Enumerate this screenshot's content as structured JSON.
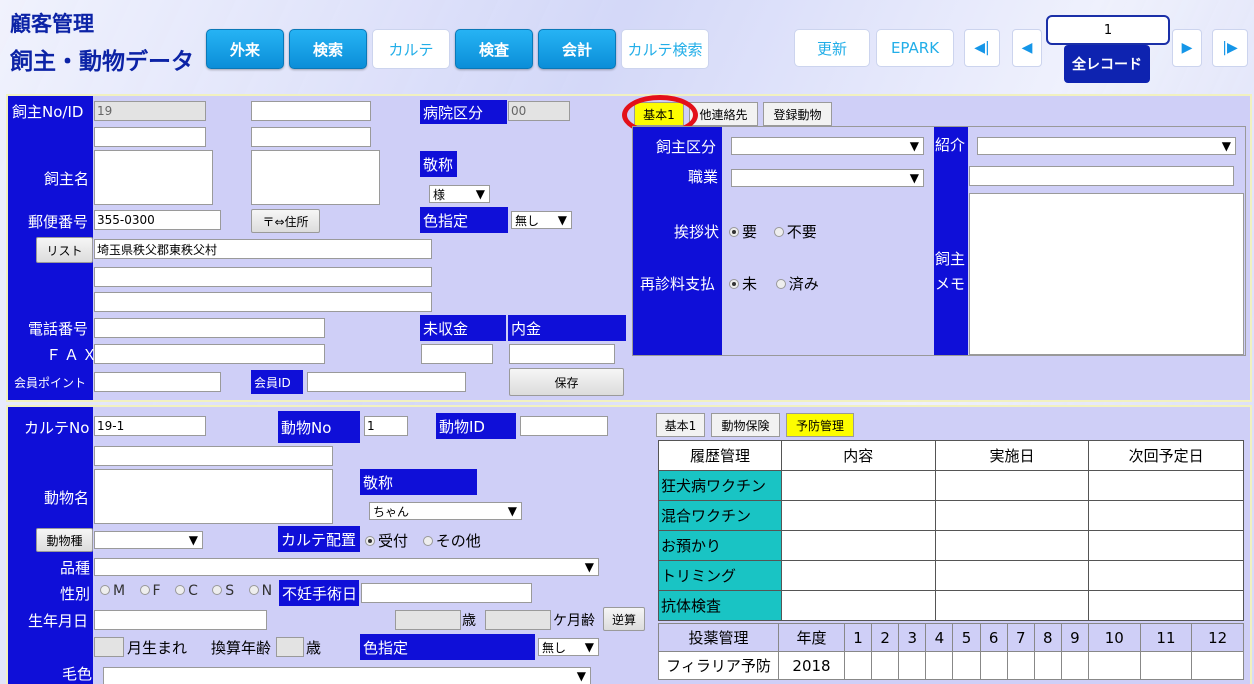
{
  "header": {
    "title1": "顧客管理",
    "title2": "飼主・動物データ"
  },
  "toolbar": {
    "outpatient": "外来",
    "search": "検索",
    "karte": "カルテ",
    "exam": "検査",
    "accounting": "会計",
    "karte_search": "カルテ検索",
    "update": "更新",
    "epark": "EPARK",
    "record_no": "1",
    "all_records": "全レコード"
  },
  "owner": {
    "id_label": "飼主No/ID",
    "id_value": "19",
    "hospital_div_label": "病院区分",
    "hospital_div_value": "00",
    "name_label": "飼主名",
    "honorific_label": "敬称",
    "honorific_value": "様",
    "zip_label": "郵便番号",
    "zip_value": "355-0300",
    "zip_to_addr_button": "〒⇔住所",
    "color_label": "色指定",
    "color_value": "無し",
    "list_button": "リスト",
    "address1": "埼玉県秩父郡東秩父村",
    "phone_label": "電話番号",
    "fax_label": "ＦＡＸ",
    "unpaid_label": "未収金",
    "deposit_label": "内金",
    "points_label": "会員ポイント",
    "member_id_label": "会員ID",
    "save_button": "保存"
  },
  "owner_tabs": {
    "basic1": "基本1",
    "other_contact": "他連絡先",
    "registered_animals": "登録動物"
  },
  "owner_basic": {
    "owner_div_label": "飼主区分",
    "job_label": "職業",
    "referral_label": "紹介",
    "greeting_label": "挨拶状",
    "greeting_yes": "要",
    "greeting_no": "不要",
    "revisit_label": "再診料支払",
    "revisit_unpaid": "未",
    "revisit_paid": "済み",
    "memo_label1": "飼主",
    "memo_label2": "メモ"
  },
  "animal": {
    "karte_no_label": "カルテNo",
    "karte_no_value": "19-1",
    "animal_no_label": "動物No",
    "animal_no_value": "1",
    "animal_id_label": "動物ID",
    "name_label": "動物名",
    "honorific_label": "敬称",
    "honorific_value": "ちゃん",
    "species_button": "動物種",
    "karte_place_label": "カルテ配置",
    "place_reception": "受付",
    "place_other": "その他",
    "breed_label": "品種",
    "sex_label": "性別",
    "sex_m": "M",
    "sex_f": "F",
    "sex_c": "C",
    "sex_s": "S",
    "sex_n": "N",
    "sterilization_label": "不妊手術日",
    "birth_label": "生年月日",
    "age_years_unit": "歳",
    "age_months_unit": "ケ月齢",
    "reverse_calc_button": "逆算",
    "birth_month_label": "月生まれ",
    "converted_age_label": "換算年齢",
    "converted_age_unit": "歳",
    "color_label": "色指定",
    "color_value": "無し",
    "fur_label": "毛色"
  },
  "animal_tabs": {
    "basic1": "基本1",
    "insurance": "動物保険",
    "prevention": "予防管理"
  },
  "history": {
    "headers": [
      "履歴管理",
      "内容",
      "実施日",
      "次回予定日"
    ],
    "rows": [
      "狂犬病ワクチン",
      "混合ワクチン",
      "お預かり",
      "トリミング",
      "抗体検査"
    ]
  },
  "dosing": {
    "headers": [
      "投薬管理",
      "年度",
      "1",
      "2",
      "3",
      "4",
      "5",
      "6",
      "7",
      "8",
      "9",
      "10",
      "11",
      "12"
    ],
    "row_label": "フィラリア予防",
    "row_year": "2018"
  }
}
